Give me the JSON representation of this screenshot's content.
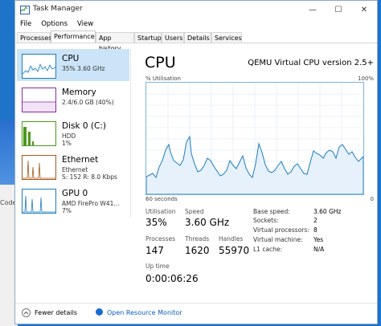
{
  "window": {
    "title": "Task Manager",
    "controls": {
      "minimize": "—",
      "maximize": "☐",
      "close": "✕"
    }
  },
  "menu": [
    "File",
    "Options",
    "View"
  ],
  "tabs": [
    "Processes",
    "Performance",
    "App history",
    "Startup",
    "Users",
    "Details",
    "Services"
  ],
  "active_tab": "Performance",
  "desktop": {
    "partial_text": "Code"
  },
  "sidebar": {
    "items": [
      {
        "name": "CPU",
        "line1": "35%  3.60 GHz",
        "line2": "",
        "color": "#1a7dc4"
      },
      {
        "name": "Memory",
        "line1": "2.4/6.0 GB (40%)",
        "line2": "",
        "color": "#8b2aa6"
      },
      {
        "name": "Disk 0 (C:)",
        "line1": "HDD",
        "line2": "1%",
        "color": "#4a9a1a"
      },
      {
        "name": "Ethernet",
        "line1": "Ethernet",
        "line2": "S: 152  R: 8.0 Kbps",
        "color": "#a65a1a"
      },
      {
        "name": "GPU 0",
        "line1": "AMD FirePro W41...",
        "line2": "7%",
        "color": "#1a7dc4"
      }
    ]
  },
  "main": {
    "title": "CPU",
    "model": "QEMU Virtual CPU version 2.5+",
    "graph_label": "% Utilisation",
    "graph_max": "100%",
    "axis_left": "60 seconds",
    "axis_right": "0",
    "stats": {
      "utilisation_label": "Utilisation",
      "utilisation": "35%",
      "speed_label": "Speed",
      "speed": "3.60 GHz",
      "processes_label": "Processes",
      "processes": "147",
      "threads_label": "Threads",
      "threads": "1620",
      "handles_label": "Handles",
      "handles": "55970",
      "uptime_label": "Up time",
      "uptime": "0:00:06:26"
    },
    "details": [
      {
        "label": "Base speed:",
        "value": "3.60 GHz"
      },
      {
        "label": "Sockets:",
        "value": "2"
      },
      {
        "label": "Virtual processors:",
        "value": "8"
      },
      {
        "label": "Virtual machine:",
        "value": "Yes"
      },
      {
        "label": "L1 cache:",
        "value": "N/A"
      }
    ]
  },
  "footer": {
    "fewer": "Fewer details",
    "monitor": "Open Resource Monitor"
  },
  "colors": {
    "accent": "#1a7dc4",
    "selected": "#cce4f7",
    "graph_fill": "#e6f1fb",
    "link": "#0a5bc4"
  }
}
